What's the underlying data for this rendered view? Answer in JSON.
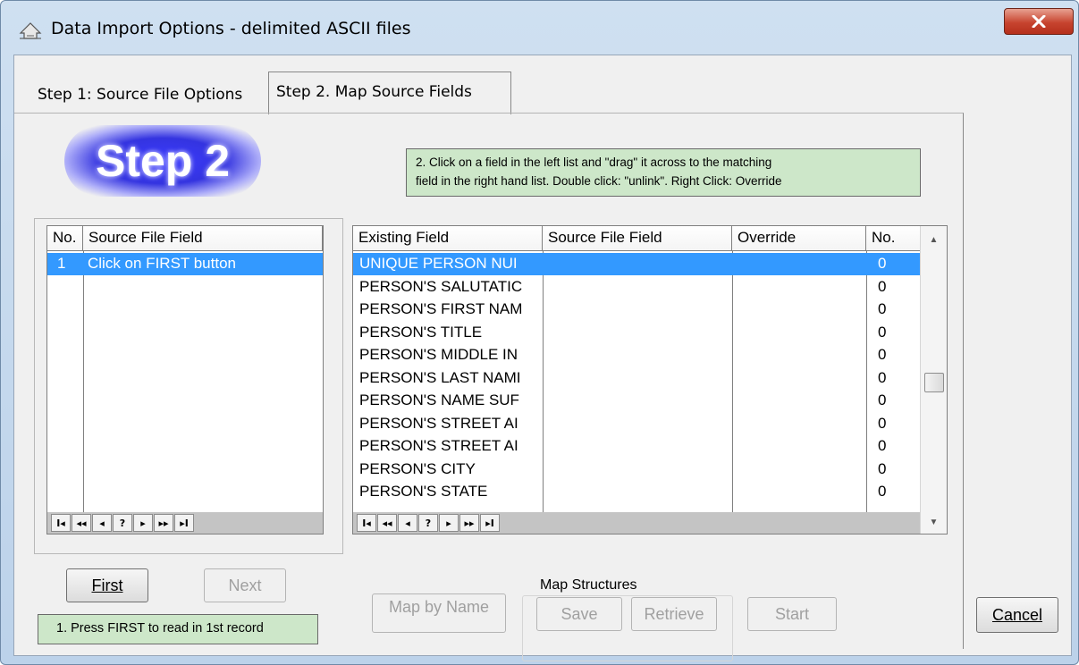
{
  "window": {
    "title": "Data Import Options - delimited ASCII files"
  },
  "tabs": [
    {
      "label": "Step 1: Source File Options"
    },
    {
      "label": "Step 2. Map Source Fields"
    }
  ],
  "step_logo": "Step 2",
  "hints": {
    "drag_line1": "2.  Click on a field in the left list and \"drag\" it across to the matching",
    "drag_line2": "field in the right hand list.  Double click: \"unlink\". Right Click: Override",
    "first_hint": "1. Press FIRST to read in 1st record"
  },
  "source_grid": {
    "headers": [
      "No.",
      "Source File Field"
    ],
    "rows": [
      {
        "no": "1",
        "field": "Click on FIRST button"
      }
    ]
  },
  "map_grid": {
    "headers": [
      "Existing Field",
      "Source File Field",
      "Override",
      "No."
    ],
    "rows": [
      {
        "field": "UNIQUE PERSON NUI",
        "no": "0"
      },
      {
        "field": "PERSON'S SALUTATIC",
        "no": "0"
      },
      {
        "field": "PERSON'S FIRST NAM",
        "no": "0"
      },
      {
        "field": "PERSON'S TITLE",
        "no": "0"
      },
      {
        "field": "PERSON'S MIDDLE IN",
        "no": "0"
      },
      {
        "field": "PERSON'S LAST NAMI",
        "no": "0"
      },
      {
        "field": "PERSON'S NAME SUF",
        "no": "0"
      },
      {
        "field": "PERSON'S STREET AI",
        "no": "0"
      },
      {
        "field": "PERSON'S STREET AI",
        "no": "0"
      },
      {
        "field": "PERSON'S CITY",
        "no": "0"
      },
      {
        "field": "PERSON'S STATE",
        "no": "0"
      }
    ]
  },
  "nav_buttons": [
    "I◂",
    "◂◂",
    "◂",
    "?",
    "▸",
    "▸▸",
    "▸I"
  ],
  "buttons": {
    "first": "First",
    "next": "Next",
    "map_by_name": "Map by Name",
    "save": "Save",
    "retrieve": "Retrieve",
    "start": "Start",
    "cancel": "Cancel"
  },
  "map_structures_label": "Map Structures",
  "icons": {
    "title": "import-icon",
    "close": "close-icon"
  },
  "colors": {
    "selection": "#3399ff",
    "hint_bg": "#cde7c9",
    "close_red": "#c7442f"
  }
}
